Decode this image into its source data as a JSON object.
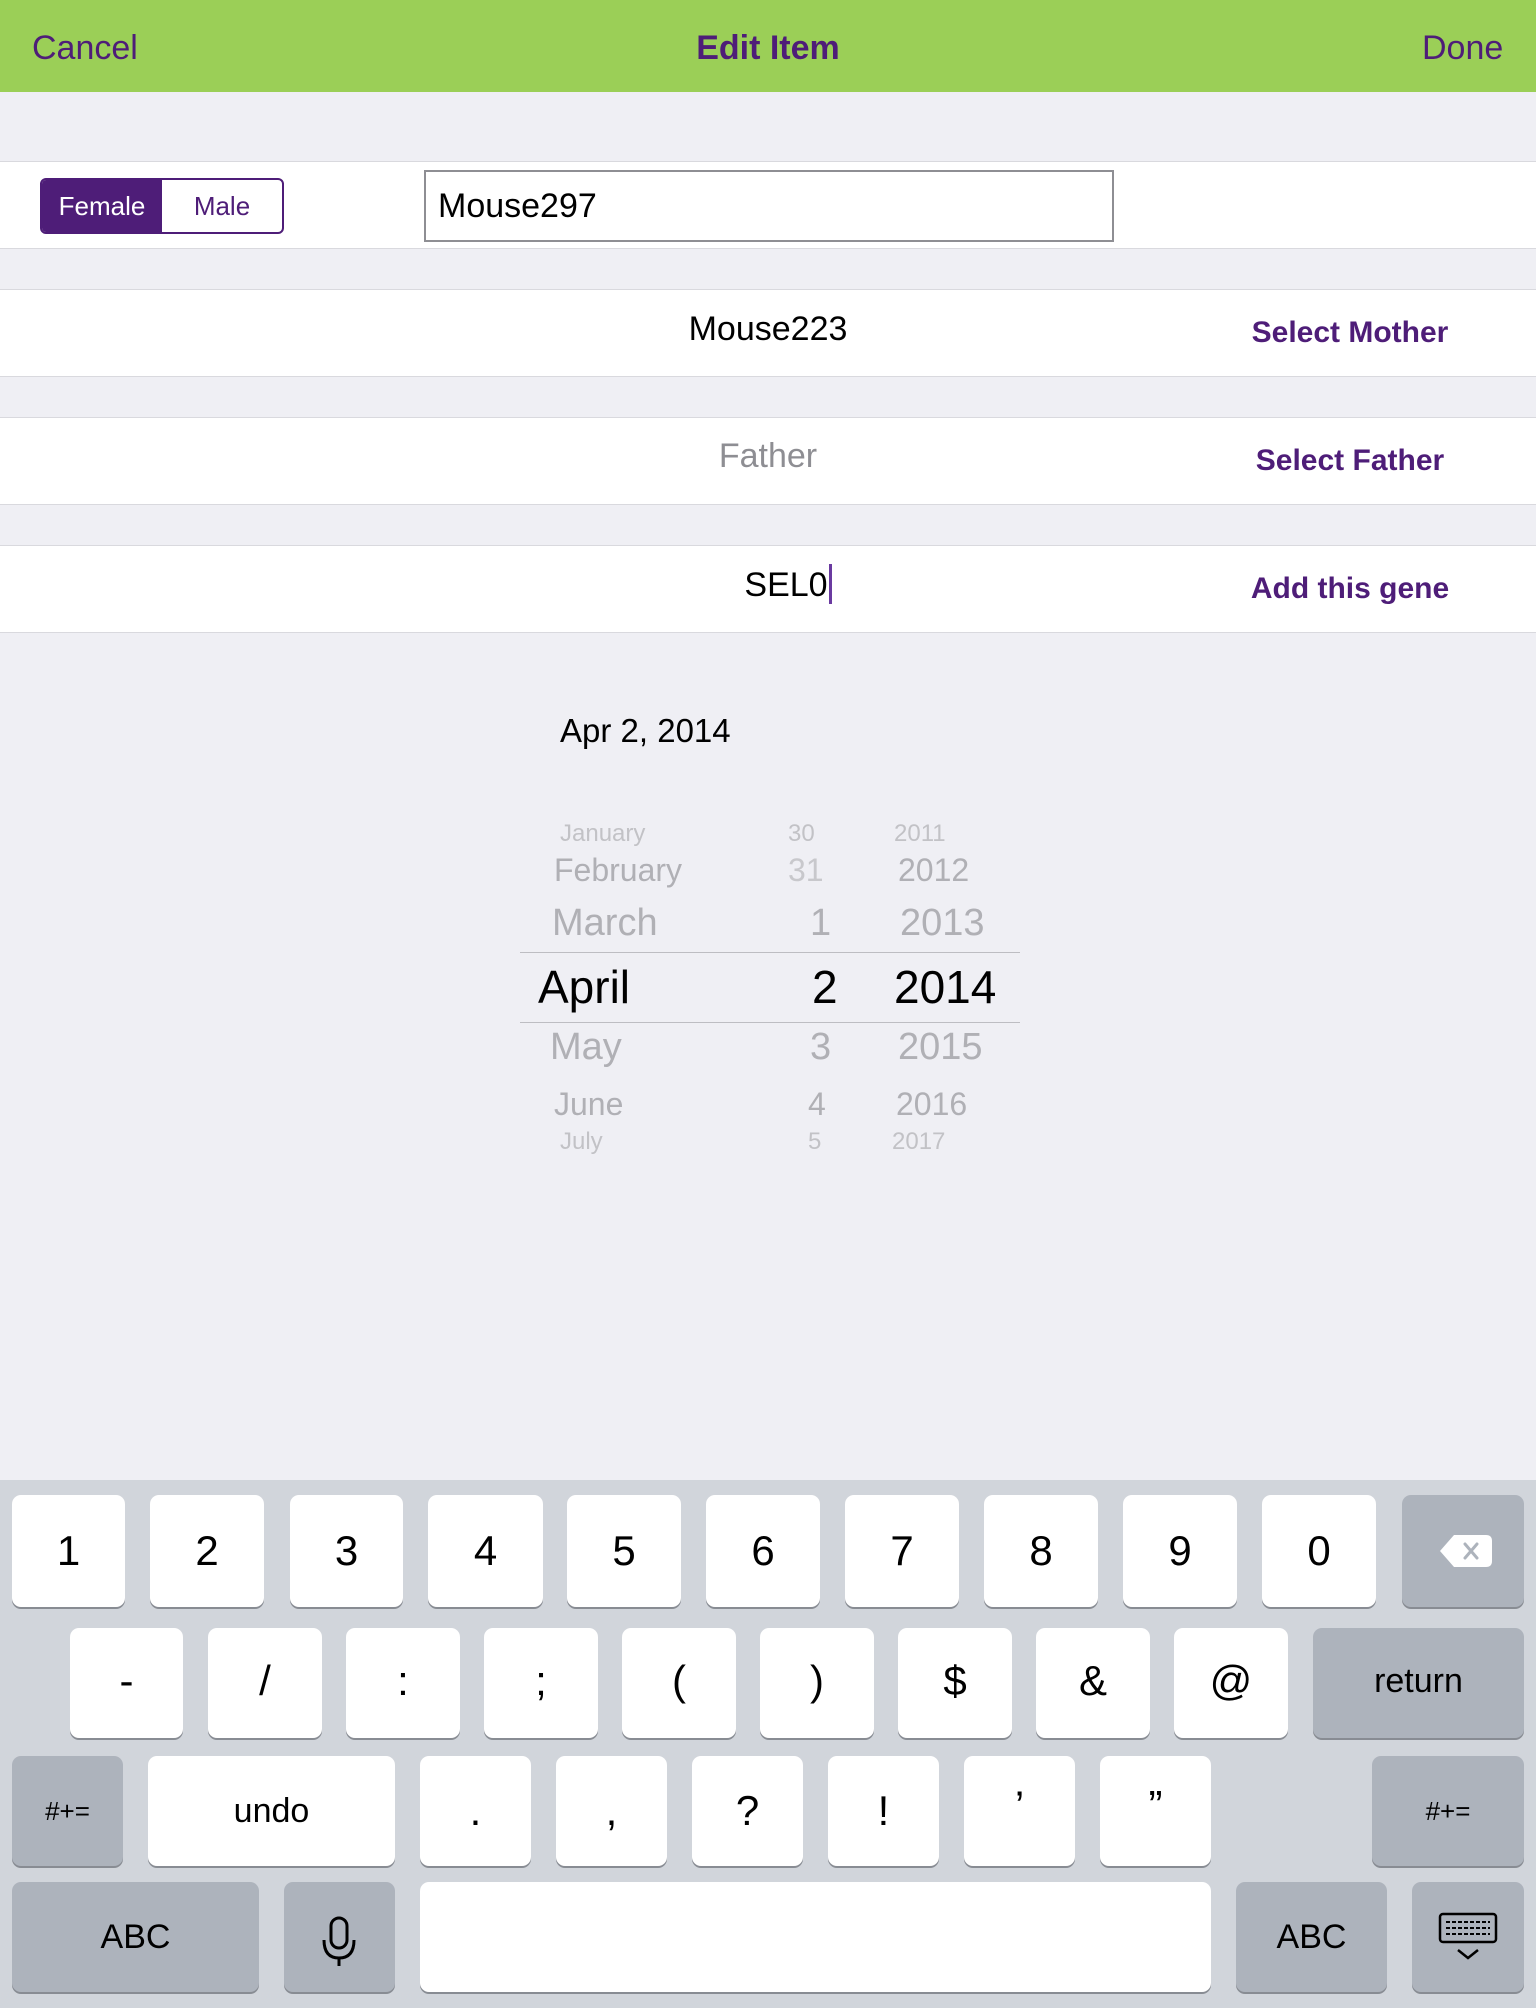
{
  "nav": {
    "cancel": "Cancel",
    "title": "Edit Item",
    "done": "Done"
  },
  "gender": {
    "female": "Female",
    "male": "Male"
  },
  "name_value": "Mouse297",
  "mother": {
    "value": "Mouse223",
    "action": "Select Mother"
  },
  "father": {
    "placeholder": "Father",
    "action": "Select Father"
  },
  "gene": {
    "value": "SEL0",
    "action": "Add this gene"
  },
  "date": {
    "label": "Apr 2, 2014",
    "months": [
      "January",
      "February",
      "March",
      "April",
      "May",
      "June",
      "July"
    ],
    "days": [
      "30",
      "31",
      "1",
      "2",
      "3",
      "4",
      "5"
    ],
    "years": [
      "2011",
      "2012",
      "2013",
      "2014",
      "2015",
      "2016",
      "2017"
    ]
  },
  "keyboard": {
    "row1": [
      "1",
      "2",
      "3",
      "4",
      "5",
      "6",
      "7",
      "8",
      "9",
      "0"
    ],
    "row2": [
      "-",
      "/",
      ":",
      ";",
      "(",
      ")",
      "$",
      "&",
      "@"
    ],
    "return": "return",
    "row3": [
      "#+=",
      "undo",
      ".",
      ",",
      "?",
      "!",
      "’",
      "”",
      "#+="
    ],
    "row4": [
      "ABC",
      "ABC"
    ],
    "icons": [
      "backspace-icon",
      "microphone-icon",
      "keyboard-dismiss-icon"
    ]
  },
  "colors": {
    "nav_bg": "#9bcf57",
    "accent": "#4e1d78"
  }
}
